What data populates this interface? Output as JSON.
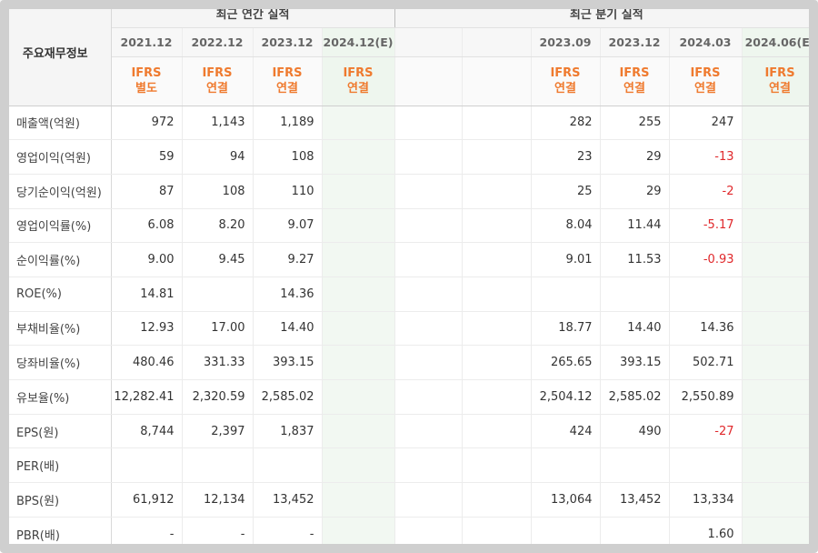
{
  "left_header": "주요재무정보",
  "groups": {
    "annual": "최근 연간 실적",
    "quarterly": "최근 분기 실적"
  },
  "annual_periods": [
    "2021.12",
    "2022.12",
    "2023.12",
    "2024.12(E)"
  ],
  "quarterly_periods": [
    "",
    "",
    "2023.09",
    "2023.12",
    "2024.03",
    "2024.06(E)"
  ],
  "annual_ifrs": [
    [
      "IFRS",
      "별도"
    ],
    [
      "IFRS",
      "연결"
    ],
    [
      "IFRS",
      "연결"
    ],
    [
      "IFRS",
      "연결"
    ]
  ],
  "quarterly_ifrs": [
    [
      "",
      ""
    ],
    [
      "",
      ""
    ],
    [
      "IFRS",
      "연결"
    ],
    [
      "IFRS",
      "연결"
    ],
    [
      "IFRS",
      "연결"
    ],
    [
      "IFRS",
      "연결"
    ]
  ],
  "colors": {
    "ifrs": "#ef7a2e",
    "negative": "#e0282b",
    "estimate_bg": "#f2f8f2"
  },
  "rows": [
    {
      "label": "매출액(억원)",
      "annual": [
        "972",
        "1,143",
        "1,189",
        ""
      ],
      "quarterly": [
        "",
        "",
        "282",
        "255",
        "247",
        ""
      ]
    },
    {
      "label": "영업이익(억원)",
      "annual": [
        "59",
        "94",
        "108",
        ""
      ],
      "quarterly": [
        "",
        "",
        "23",
        "29",
        "-13",
        ""
      ]
    },
    {
      "label": "당기순이익(억원)",
      "annual": [
        "87",
        "108",
        "110",
        ""
      ],
      "quarterly": [
        "",
        "",
        "25",
        "29",
        "-2",
        ""
      ]
    },
    {
      "label": "영업이익률(%)",
      "annual": [
        "6.08",
        "8.20",
        "9.07",
        ""
      ],
      "quarterly": [
        "",
        "",
        "8.04",
        "11.44",
        "-5.17",
        ""
      ]
    },
    {
      "label": "순이익률(%)",
      "annual": [
        "9.00",
        "9.45",
        "9.27",
        ""
      ],
      "quarterly": [
        "",
        "",
        "9.01",
        "11.53",
        "-0.93",
        ""
      ]
    },
    {
      "label": "ROE(%)",
      "annual": [
        "14.81",
        "",
        "14.36",
        ""
      ],
      "quarterly": [
        "",
        "",
        "",
        "",
        "",
        ""
      ]
    },
    {
      "label": "부채비율(%)",
      "annual": [
        "12.93",
        "17.00",
        "14.40",
        ""
      ],
      "quarterly": [
        "",
        "",
        "18.77",
        "14.40",
        "14.36",
        ""
      ]
    },
    {
      "label": "당좌비율(%)",
      "annual": [
        "480.46",
        "331.33",
        "393.15",
        ""
      ],
      "quarterly": [
        "",
        "",
        "265.65",
        "393.15",
        "502.71",
        ""
      ]
    },
    {
      "label": "유보율(%)",
      "annual": [
        "12,282.41",
        "2,320.59",
        "2,585.02",
        ""
      ],
      "quarterly": [
        "",
        "",
        "2,504.12",
        "2,585.02",
        "2,550.89",
        ""
      ]
    },
    {
      "label": "EPS(원)",
      "annual": [
        "8,744",
        "2,397",
        "1,837",
        ""
      ],
      "quarterly": [
        "",
        "",
        "424",
        "490",
        "-27",
        ""
      ]
    },
    {
      "label": "PER(배)",
      "annual": [
        "",
        "",
        "",
        ""
      ],
      "quarterly": [
        "",
        "",
        "",
        "",
        "",
        ""
      ]
    },
    {
      "label": "BPS(원)",
      "annual": [
        "61,912",
        "12,134",
        "13,452",
        ""
      ],
      "quarterly": [
        "",
        "",
        "13,064",
        "13,452",
        "13,334",
        ""
      ]
    },
    {
      "label": "PBR(배)",
      "annual": [
        "-",
        "-",
        "-",
        ""
      ],
      "quarterly": [
        "",
        "",
        "",
        "",
        "1.60",
        ""
      ]
    }
  ]
}
